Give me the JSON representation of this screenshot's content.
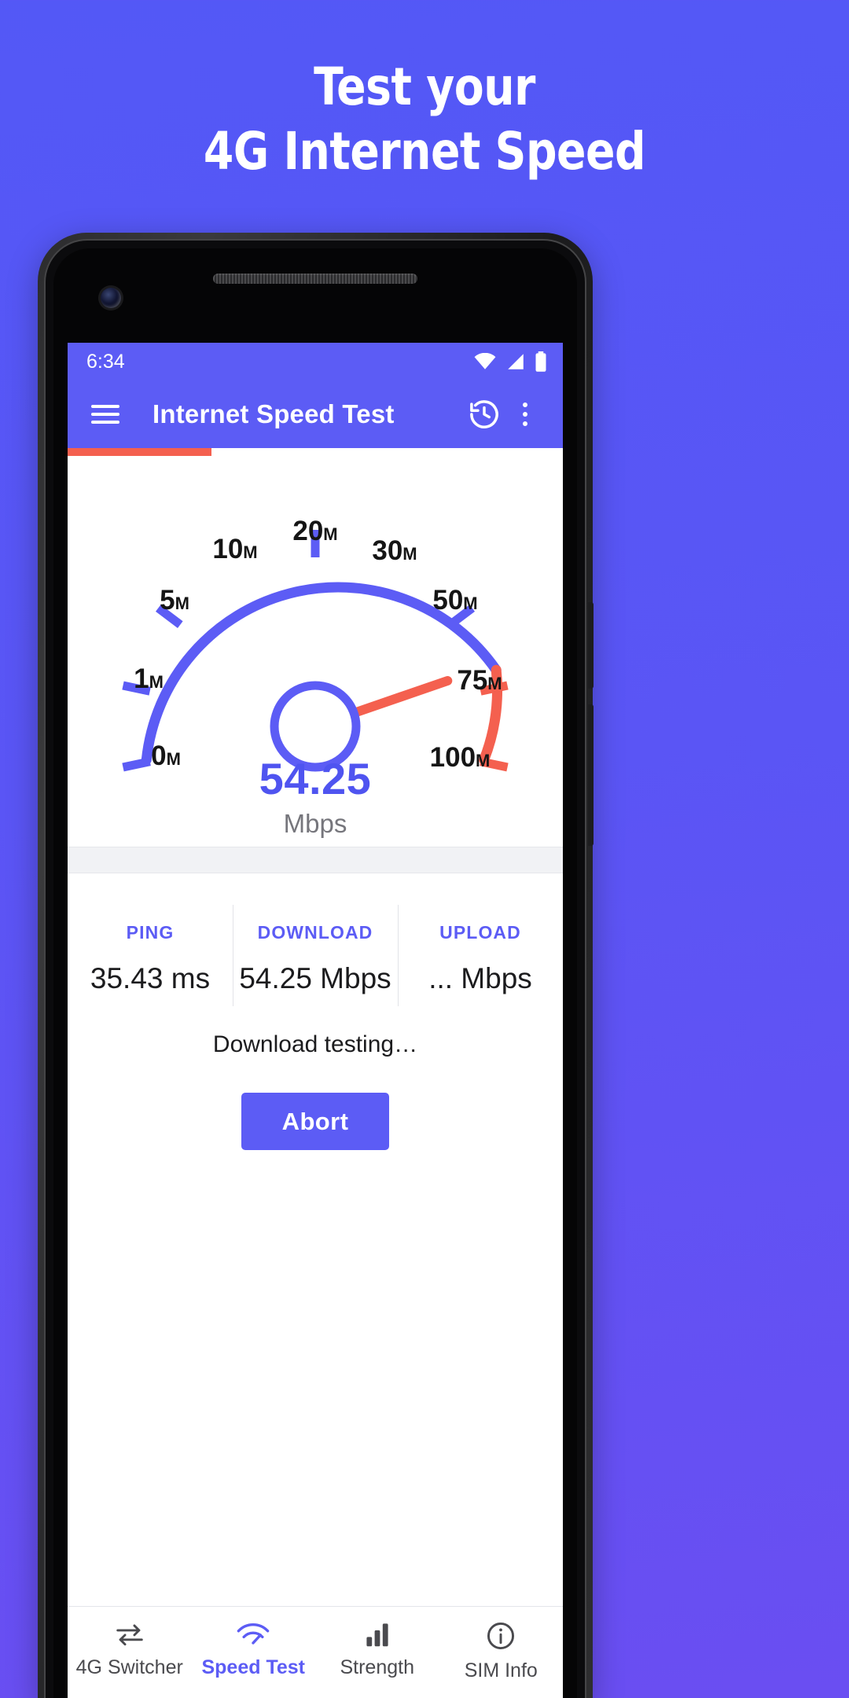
{
  "promo": {
    "line1": "Test your",
    "line2": "4G Internet Speed",
    "bg_start": "#5358f6",
    "bg_end": "#6a4ef2"
  },
  "statusbar": {
    "time": "6:34",
    "icons": [
      "wifi-icon",
      "cellular-signal-icon",
      "battery-icon"
    ]
  },
  "appbar": {
    "menu_icon": "hamburger-menu-icon",
    "title": "Internet Speed Test",
    "history_icon": "history-clock-icon",
    "overflow_icon": "overflow-menu-icon",
    "background": "#5c5cf5"
  },
  "progress": {
    "percent": 29,
    "color": "#f4604f"
  },
  "gauge": {
    "value": "54.25",
    "unit": "Mbps",
    "value_color": "#4f54f0",
    "arc_color": "#5c5cf5",
    "arc_hot_color": "#f4604f",
    "needle_color": "#f4604f",
    "ticks": [
      {
        "label": "0",
        "suffix": "M"
      },
      {
        "label": "1",
        "suffix": "M"
      },
      {
        "label": "5",
        "suffix": "M"
      },
      {
        "label": "10",
        "suffix": "M"
      },
      {
        "label": "20",
        "suffix": "M"
      },
      {
        "label": "30",
        "suffix": "M"
      },
      {
        "label": "50",
        "suffix": "M"
      },
      {
        "label": "75",
        "suffix": "M"
      },
      {
        "label": "100",
        "suffix": "M"
      }
    ]
  },
  "stats": [
    {
      "key": "PING",
      "value": "35.43 ms"
    },
    {
      "key": "DOWNLOAD",
      "value": "54.25 Mbps"
    },
    {
      "key": "UPLOAD",
      "value": "... Mbps"
    }
  ],
  "status_message": "Download testing…",
  "abort_button": "Abort",
  "bottomnav": [
    {
      "label": "4G Switcher",
      "icon": "swap-arrows-icon",
      "active": false
    },
    {
      "label": "Speed Test",
      "icon": "speedometer-wifi-icon",
      "active": true
    },
    {
      "label": "Strength",
      "icon": "signal-bars-icon",
      "active": false
    },
    {
      "label": "SIM Info",
      "icon": "info-circle-icon",
      "active": false
    }
  ]
}
